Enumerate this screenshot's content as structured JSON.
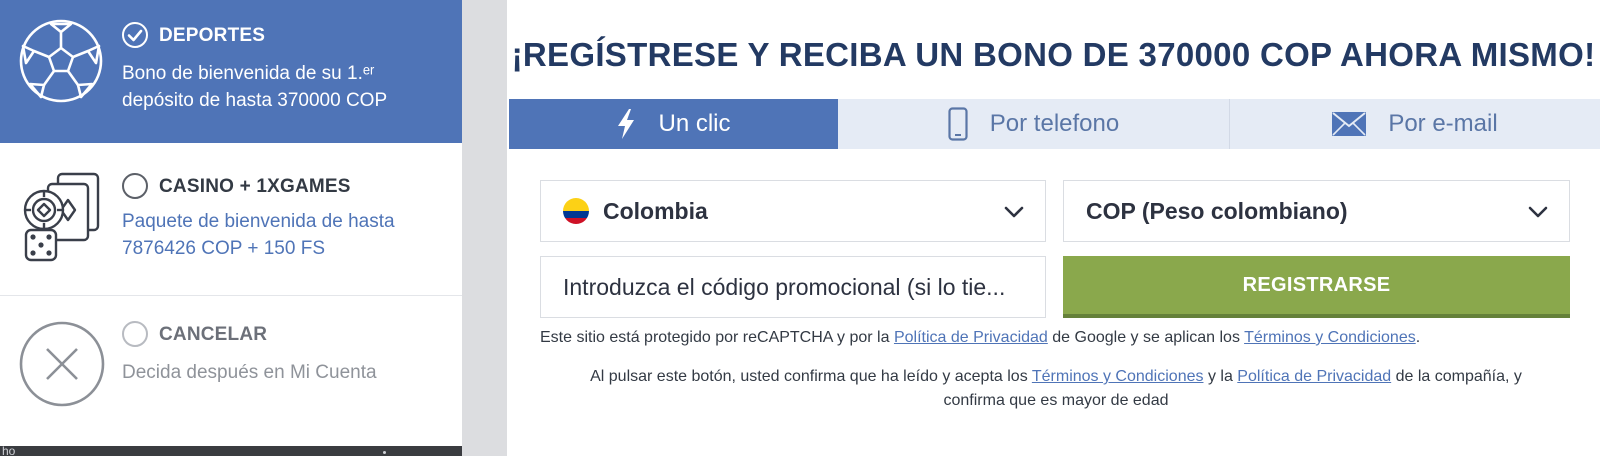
{
  "bonus": {
    "sports": {
      "title": "DEPORTES",
      "desc_line1": "Bono de bienvenida de su 1.ᵉʳ",
      "desc_line2": "depósito de hasta 370000 COP",
      "icon": "soccer-ball-icon",
      "selected": true
    },
    "casino": {
      "title": "CASINO + 1XGAMES",
      "desc_line1": "Paquete de bienvenida de hasta",
      "desc_line2": "7876426 COP + 150 FS",
      "icon": "casino-chips-cards-icon",
      "selected": false
    },
    "cancel": {
      "title": "CANCELAR",
      "desc": "Decida después en Mi Cuenta",
      "icon": "close-circle-icon",
      "selected": false
    }
  },
  "background_text": "ho",
  "registration": {
    "headline": "¡REGÍSTRESE Y RECIBA UN BONO DE 370000 COP AHORA MISMO!",
    "tabs": [
      {
        "label": "Un clic",
        "icon": "lightning-icon",
        "active": true
      },
      {
        "label": "Por telefono",
        "icon": "phone-icon",
        "active": false
      },
      {
        "label": "Por e-mail",
        "icon": "envelope-icon",
        "active": false
      }
    ],
    "country": {
      "value": "Colombia",
      "flag_colors": [
        "#fcd116",
        "#003893",
        "#ce1126"
      ]
    },
    "currency": {
      "value": "COP (Peso colombiano)"
    },
    "promo": {
      "placeholder": "Introduzca el código promocional (si lo tie..."
    },
    "register_label": "REGISTRARSE",
    "recaptcha": {
      "prefix": "Este sitio está protegido por reCAPTCHA y por la",
      "privacy_link": "Política de Privacidad",
      "middle": "de Google y se aplican los",
      "terms_link": "Términos y Condiciones",
      "suffix": "."
    },
    "consent": {
      "prefix": "Al pulsar este botón, usted confirma que ha leído y acepta los",
      "terms_link": "Términos y Condiciones",
      "middle": "y la",
      "privacy_link": "Política de Privacidad",
      "suffix": "de la compañía, y",
      "line2": "confirma que es mayor de edad"
    }
  },
  "colors": {
    "accent_blue": "#4f74b7",
    "headline_navy": "#233a63",
    "register_green": "#8aa84c",
    "tab_inactive_bg": "#e5ebf5"
  }
}
